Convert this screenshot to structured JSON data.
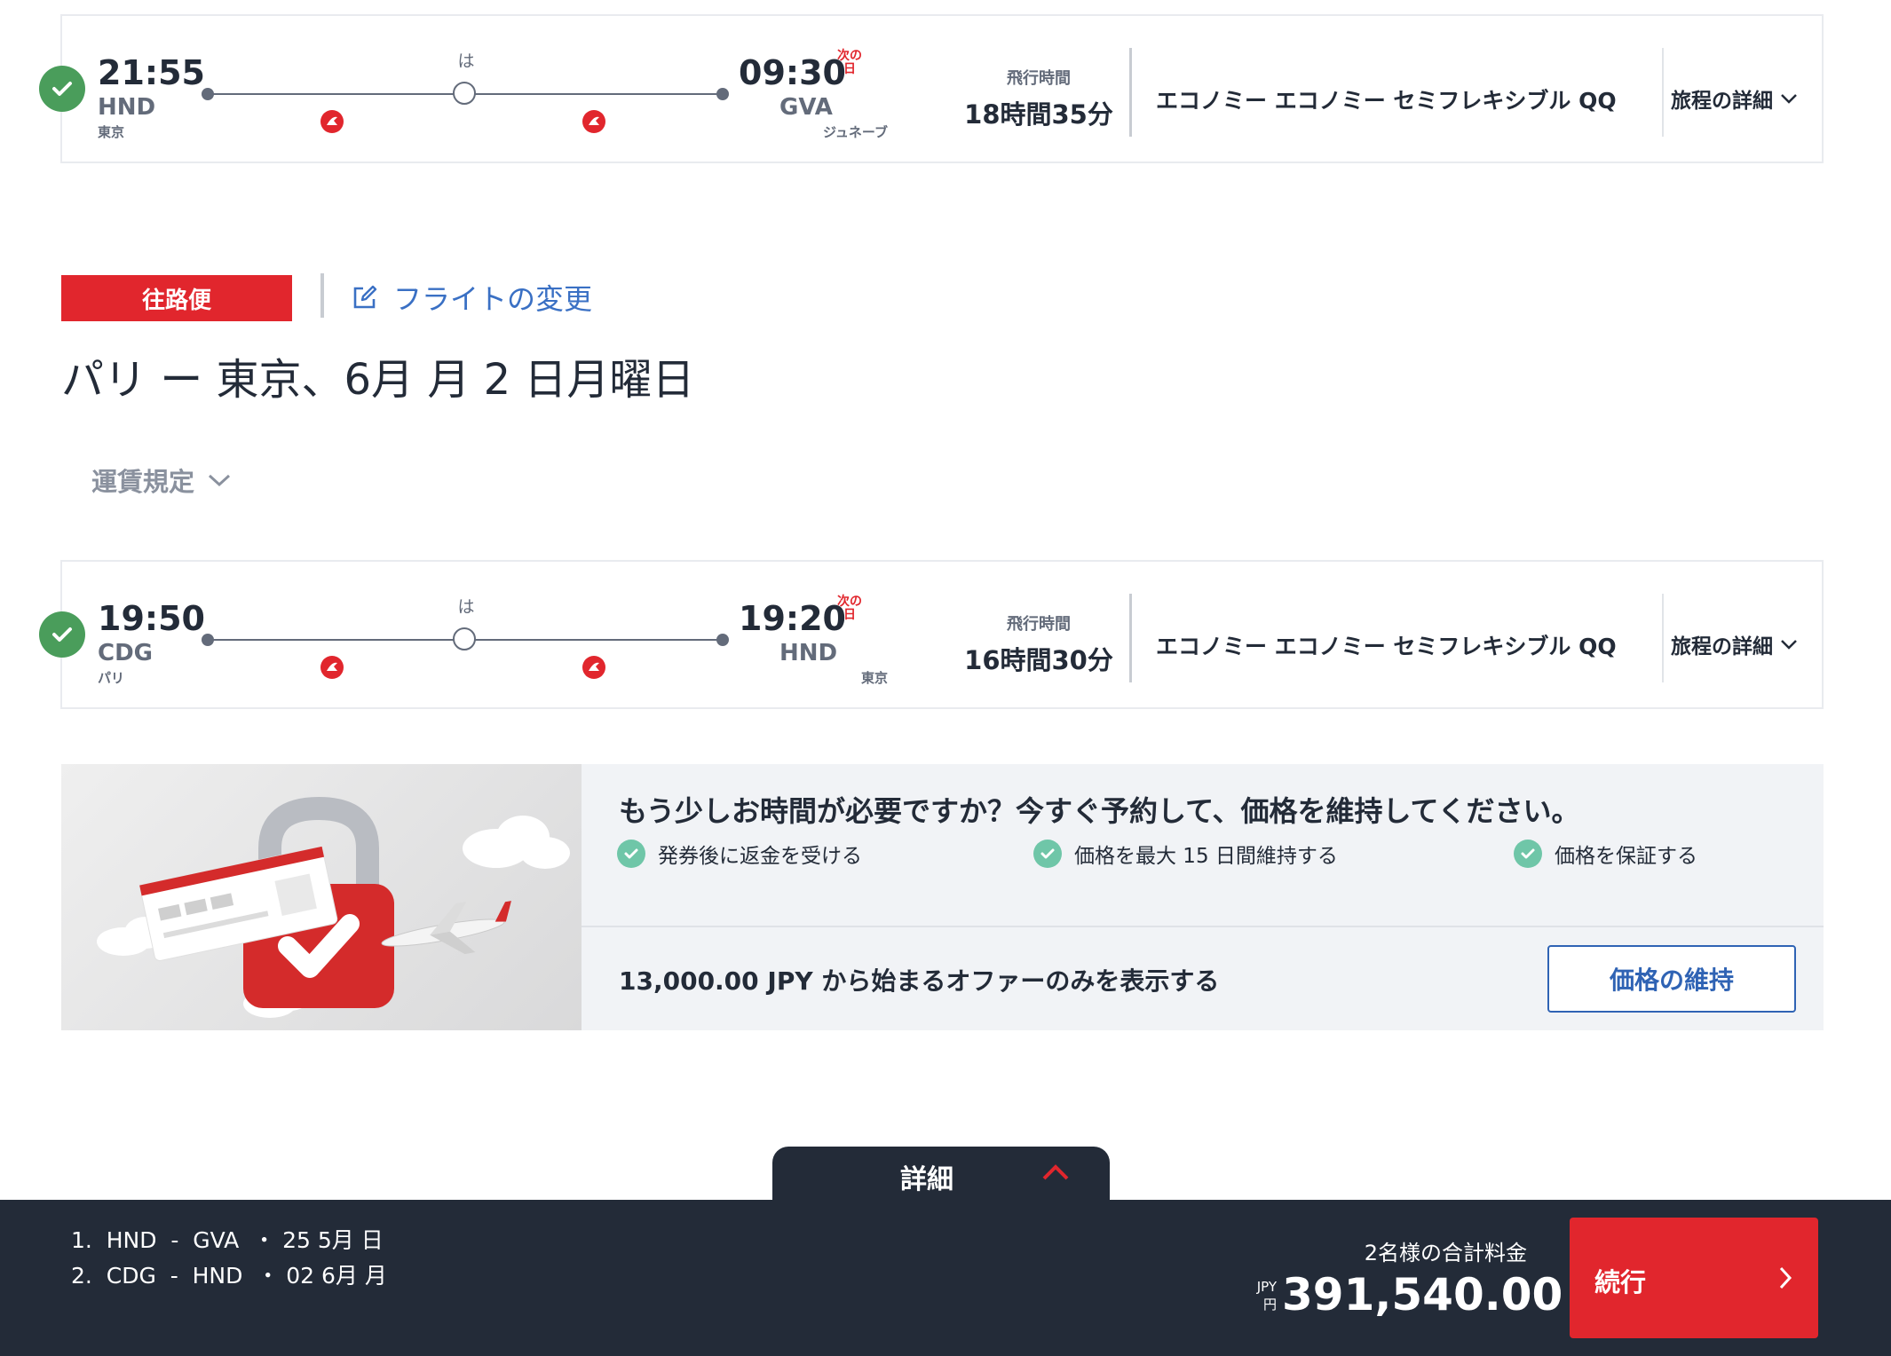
{
  "outbound_flight": {
    "dep_time": "21:55",
    "dep_code": "HND",
    "dep_city": "東京",
    "arr_time": "09:30",
    "next_day": "次の日",
    "arr_code": "GVA",
    "arr_city": "ジュネーブ",
    "stop_label": "は",
    "duration_label": "飛行時間",
    "duration": "18時間35分",
    "fare_class": "エコノミー エコノミー セミフレキシブル QQ",
    "itinerary_details": "旅程の詳細"
  },
  "return_header": {
    "direction_label": "往路便",
    "change_flight": "フライトの変更",
    "route_title": "パリ ー 東京、6月 月 2 日月曜日",
    "fare_rules": "運賃規定"
  },
  "return_flight": {
    "dep_time": "19:50",
    "dep_code": "CDG",
    "dep_city": "パリ",
    "arr_time": "19:20",
    "next_day": "次の日",
    "arr_code": "HND",
    "arr_city": "東京",
    "stop_label": "は",
    "duration_label": "飛行時間",
    "duration": "16時間30分",
    "fare_class": "エコノミー エコノミー セミフレキシブル QQ",
    "itinerary_details": "旅程の詳細"
  },
  "hold_price": {
    "headline": "もう少しお時間が必要ですか？今すぐ予約して、価格を維持してください。",
    "benefits": [
      "発券後に返金を受ける",
      "価格を最大 15 日間維持する",
      "価格を保証する"
    ],
    "offer_text": "13,000.00 JPY から始まるオファーのみを表示する",
    "button": "価格の維持"
  },
  "footer": {
    "details_tab": "詳細",
    "segment_1": "1.  HND  -  GVA  ・ 25 5月 日",
    "segment_2": "2.  CDG  -  HND  ・ 02 6月 月",
    "total_label": "2名様の合計料金",
    "currency_code": "JPY",
    "currency_symbol": "円",
    "total_amount": "391,540.00",
    "continue": "続行"
  },
  "colors": {
    "brand_red": "#e1262d",
    "dark_bar": "#232b38",
    "link_blue": "#3a70c4",
    "check_green": "#4a9d5b",
    "benefit_green": "#6fc6a8"
  },
  "icons": [
    "check-icon",
    "airline-logo-icon",
    "chevron-down-icon",
    "edit-icon",
    "chevron-up-icon",
    "chevron-right-icon"
  ]
}
